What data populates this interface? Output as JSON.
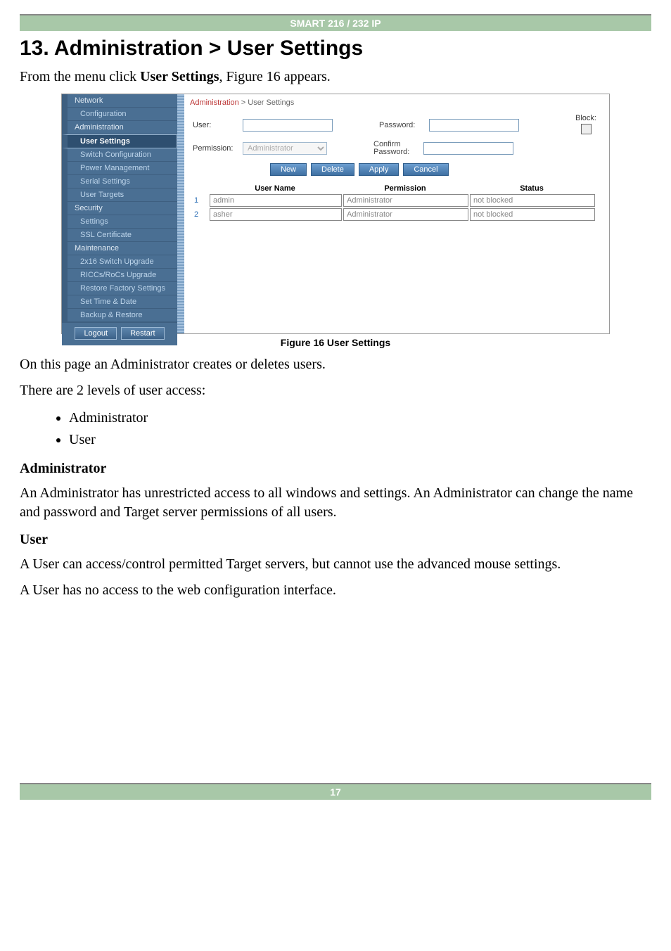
{
  "header_bar": "SMART 216 / 232 IP",
  "section_title": "13. Administration > User Settings",
  "intro_prefix": "From the menu click ",
  "intro_bold": "User Settings",
  "intro_suffix": ", Figure 16 appears.",
  "figure_caption": "Figure 16 User Settings",
  "para_after_fig": "On this page an Administrator creates or deletes users.",
  "para_levels": "There are 2 levels of user access:",
  "levels": [
    "Administrator",
    "User"
  ],
  "admin_head": "Administrator",
  "admin_para": "An Administrator has unrestricted access to all windows and settings. An Administrator can change the name and password and Target server permissions of all users.",
  "user_head": "User",
  "user_para1": "A User can access/control permitted Target servers, but cannot use the advanced mouse settings.",
  "user_para2": "A User has no access to the web configuration interface.",
  "page_number": "17",
  "sidebar": {
    "groups": [
      {
        "label": "Network",
        "type": "header"
      },
      {
        "label": "Configuration",
        "type": "sub"
      },
      {
        "label": "Administration",
        "type": "header"
      },
      {
        "label": "User Settings",
        "type": "sub",
        "selected": true
      },
      {
        "label": "Switch Configuration",
        "type": "sub"
      },
      {
        "label": "Power Management",
        "type": "sub"
      },
      {
        "label": "Serial Settings",
        "type": "sub"
      },
      {
        "label": "User Targets",
        "type": "sub"
      },
      {
        "label": "Security",
        "type": "header"
      },
      {
        "label": "Settings",
        "type": "sub"
      },
      {
        "label": "SSL Certificate",
        "type": "sub"
      },
      {
        "label": "Maintenance",
        "type": "header"
      },
      {
        "label": "2x16 Switch Upgrade",
        "type": "sub"
      },
      {
        "label": "RICCs/RoCs Upgrade",
        "type": "sub"
      },
      {
        "label": "Restore Factory Settings",
        "type": "sub"
      },
      {
        "label": "Set Time & Date",
        "type": "sub"
      },
      {
        "label": "Backup & Restore",
        "type": "sub"
      }
    ],
    "logout": "Logout",
    "restart": "Restart"
  },
  "breadcrumb": {
    "root": "Administration",
    "sep": " > ",
    "page": "User Settings"
  },
  "form": {
    "user_label": "User:",
    "permission_label": "Permission:",
    "permission_value": "Administrator",
    "password_label": "Password:",
    "confirm_label": "Confirm Password:",
    "block_label": "Block:"
  },
  "buttons": {
    "new": "New",
    "delete": "Delete",
    "apply": "Apply",
    "cancel": "Cancel"
  },
  "table": {
    "headers": {
      "name": "User Name",
      "perm": "Permission",
      "status": "Status"
    },
    "rows": [
      {
        "n": "1",
        "name": "admin",
        "perm": "Administrator",
        "status": "not blocked"
      },
      {
        "n": "2",
        "name": "asher",
        "perm": "Administrator",
        "status": "not blocked"
      }
    ]
  }
}
